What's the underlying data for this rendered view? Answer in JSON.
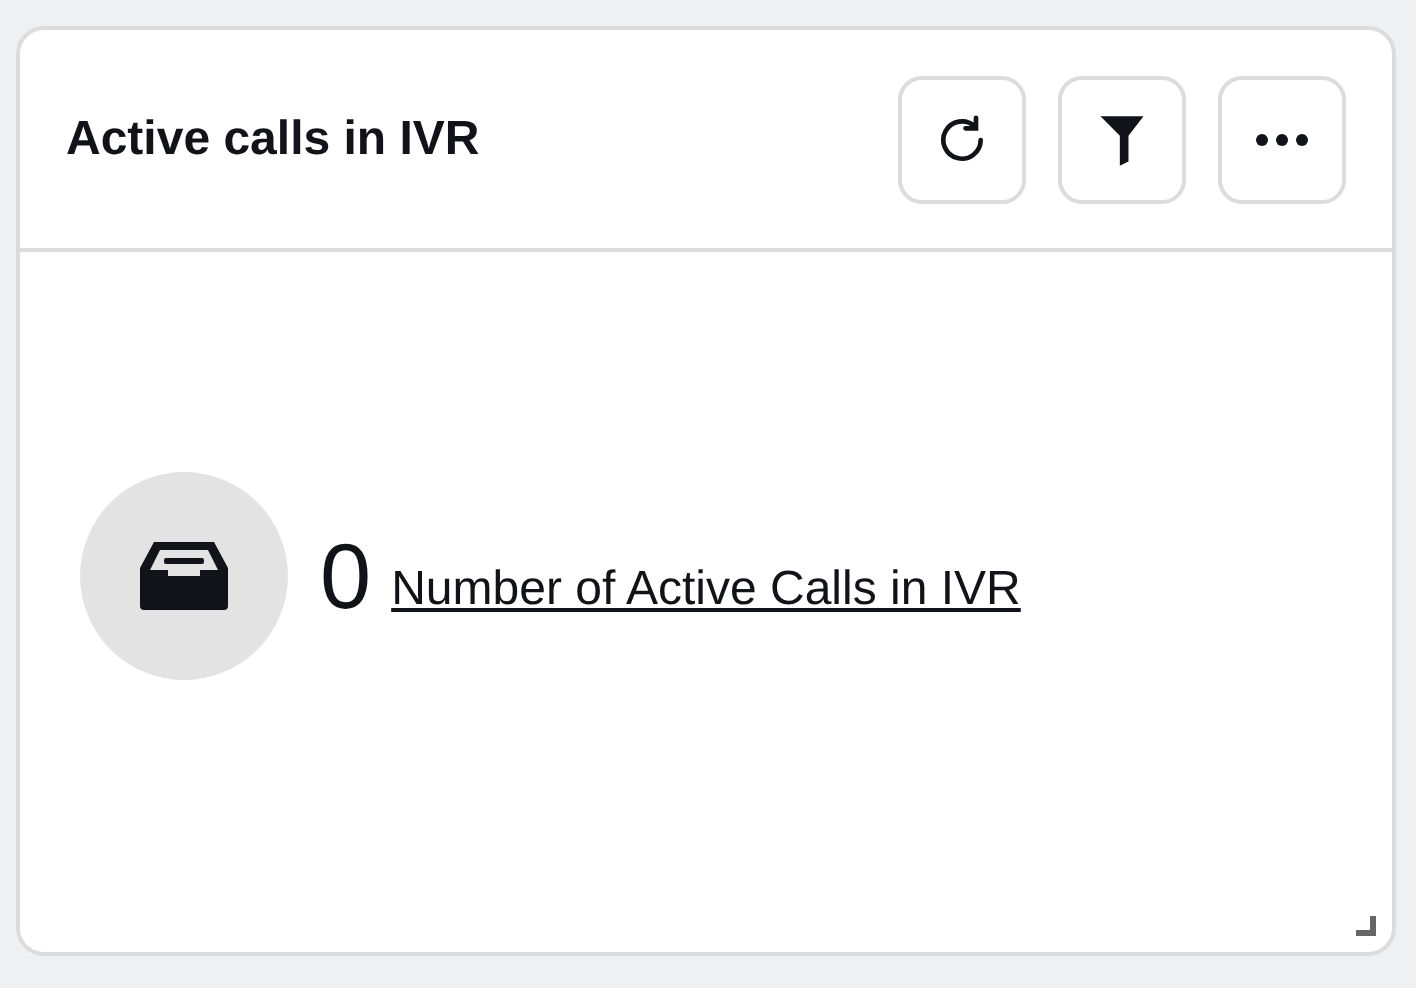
{
  "card": {
    "title": "Active calls in IVR",
    "actions": [
      {
        "kind": "refresh"
      },
      {
        "kind": "filter"
      },
      {
        "kind": "more"
      }
    ],
    "metric": {
      "value": "0",
      "label": "Number of Active Calls in IVR"
    }
  }
}
